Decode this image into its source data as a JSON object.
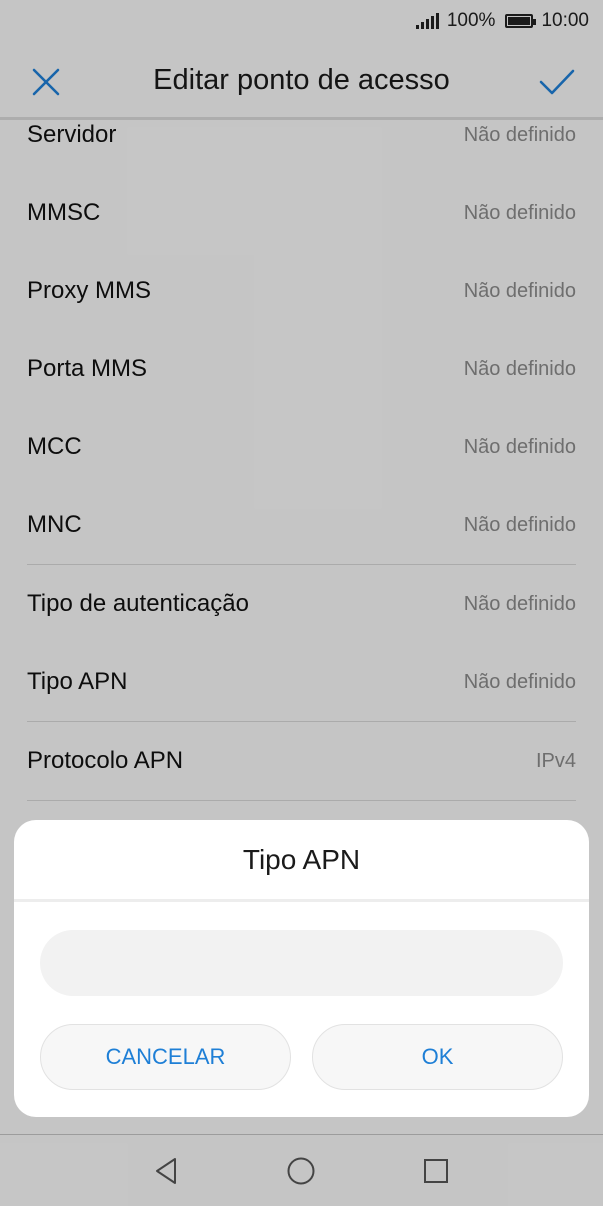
{
  "status_bar": {
    "battery": "100%",
    "time": "10:00"
  },
  "app_bar": {
    "title": "Editar ponto de acesso"
  },
  "settings": [
    {
      "label": "Servidor",
      "value": "Não definido"
    },
    {
      "label": "MMSC",
      "value": "Não definido"
    },
    {
      "label": "Proxy MMS",
      "value": "Não definido"
    },
    {
      "label": "Porta MMS",
      "value": "Não definido"
    },
    {
      "label": "MCC",
      "value": "Não definido"
    },
    {
      "label": "MNC",
      "value": "Não definido"
    },
    {
      "label": "Tipo de autenticação",
      "value": "Não definido"
    },
    {
      "label": "Tipo APN",
      "value": "Não definido"
    },
    {
      "label": "Protocolo APN",
      "value": "IPv4"
    }
  ],
  "dialog": {
    "title": "Tipo APN",
    "input_value": "",
    "cancel_label": "CANCELAR",
    "ok_label": "OK"
  },
  "icons": {
    "close": "close-icon",
    "confirm": "checkmark-icon",
    "back": "back-triangle-icon",
    "home": "home-circle-icon",
    "recents": "recents-square-icon"
  },
  "colors": {
    "accent": "#1e7fd6"
  }
}
